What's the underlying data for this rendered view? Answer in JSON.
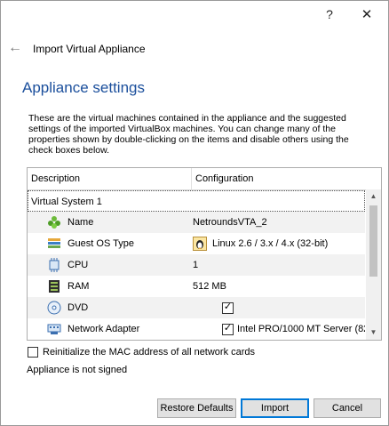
{
  "window": {
    "help_glyph": "?",
    "close_glyph": "✕"
  },
  "wizard": {
    "back_glyph": "←",
    "title": "Import Virtual Appliance"
  },
  "section": {
    "title": "Appliance settings"
  },
  "description": "These are the virtual machines contained in the appliance and the suggested settings of the imported VirtualBox machines. You can change many of the properties shown by double-clicking on the items and disable others using the check boxes below.",
  "table": {
    "headers": {
      "description": "Description",
      "configuration": "Configuration"
    },
    "system_label": "Virtual System 1",
    "rows": [
      {
        "label": "Name",
        "value": "NetroundsVTA_2",
        "icon": "name-icon"
      },
      {
        "label": "Guest OS Type",
        "value": "Linux 2.6 / 3.x / 4.x (32-bit)",
        "icon": "os-type-icon",
        "value_icon": "linux-os-icon"
      },
      {
        "label": "CPU",
        "value": "1",
        "icon": "cpu-icon"
      },
      {
        "label": "RAM",
        "value": "512 MB",
        "icon": "ram-icon"
      },
      {
        "label": "DVD",
        "value": "",
        "icon": "dvd-icon",
        "checked": true
      },
      {
        "label": "Network Adapter",
        "value": "Intel PRO/1000 MT Server (825...",
        "icon": "network-adapter-icon",
        "checked": true
      }
    ]
  },
  "options": {
    "reinit_mac_label": "Reinitialize the MAC address of all network cards",
    "reinit_mac_checked": false
  },
  "signed_status": "Appliance is not signed",
  "buttons": {
    "restore": "Restore Defaults",
    "import": "Import",
    "cancel": "Cancel"
  },
  "colors": {
    "accent": "#0078d7",
    "section_title": "#1b4f9c"
  }
}
